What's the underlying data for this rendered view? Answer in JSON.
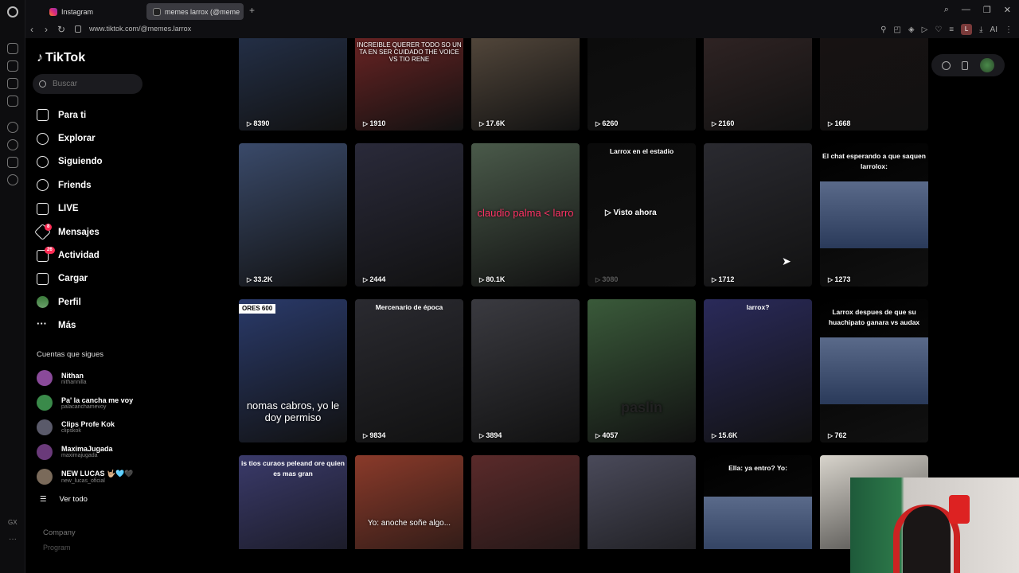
{
  "browser": {
    "tabs": [
      {
        "label": "Instagram"
      },
      {
        "label": "memes larrox (@meme"
      }
    ],
    "url": "www.tiktok.com/@memes.larrox",
    "profile_letter": "L",
    "ai_label": "AI",
    "gx_label": "GX"
  },
  "tiktok": {
    "brand": "TikTok",
    "search_placeholder": "Buscar",
    "nav": [
      {
        "label": "Para ti",
        "icon": "home-icon"
      },
      {
        "label": "Explorar",
        "icon": "compass-icon"
      },
      {
        "label": "Siguiendo",
        "icon": "person-plus-icon"
      },
      {
        "label": "Friends",
        "icon": "people-icon"
      },
      {
        "label": "LIVE",
        "icon": "live-icon"
      },
      {
        "label": "Mensajes",
        "icon": "paper-plane-icon",
        "badge": "8"
      },
      {
        "label": "Actividad",
        "icon": "inbox-icon",
        "badge": "26"
      },
      {
        "label": "Cargar",
        "icon": "plus-square-icon"
      },
      {
        "label": "Perfil",
        "icon": "avatar-icon"
      },
      {
        "label": "Más",
        "icon": "more-dots-icon"
      }
    ],
    "following_header": "Cuentas que sigues",
    "following": [
      {
        "name": "Nithan",
        "user": "nithannilla",
        "color": "#8a4a9a"
      },
      {
        "name": "Pa' la cancha me voy",
        "user": "palacanchamevoy",
        "color": "#3a8a4a"
      },
      {
        "name": "Clips Profe Kok",
        "user": "clipskok",
        "color": "#5a5a6a"
      },
      {
        "name": "MaximaJugada",
        "user": "maximajugada",
        "color": "#6a3a7a"
      },
      {
        "name": "NEW LUCAS 🤟🏼🩵🖤",
        "user": "new_lucas_oficial",
        "color": "#7a6a5a"
      }
    ],
    "see_all": "Ver todo",
    "footer": [
      "Company",
      "Program"
    ]
  },
  "videos": [
    {
      "views": "8390",
      "bg": "#2a3a5a"
    },
    {
      "views": "1910",
      "bg": "#8a2a2a",
      "caption": "INCREIBLE QUERER TODO SO UN TA EN SER CUIDADO THE VOICE VS TIO RENE"
    },
    {
      "views": "17.6K",
      "bg": "#6a5a4a"
    },
    {
      "views": "6260",
      "bg": "#0a0a0a"
    },
    {
      "views": "2160",
      "bg": "#3a2a2a"
    },
    {
      "views": "1668",
      "bg": "#1a1212"
    },
    {
      "views": "33.2K",
      "bg": "#3a4a6a"
    },
    {
      "views": "2444",
      "bg": "#2a2a3a"
    },
    {
      "views": "80.1K",
      "bg": "#4a5a4a",
      "caption": "claudio palma < larro"
    },
    {
      "views": "3080",
      "bg": "#0a0a0a",
      "top": "Larrox en el estadio",
      "watch": "▷ Visto ahora"
    },
    {
      "views": "1712",
      "bg": "#2a2a30"
    },
    {
      "views": "1273",
      "bg": "#000000",
      "top": "El chat esperando  a que saquen larrolox:"
    },
    {
      "views": "",
      "bg": "#2a3a6a",
      "caption": "nomas cabros, yo le doy permiso",
      "score": "ORES 600"
    },
    {
      "views": "9834",
      "bg": "#2a2a30",
      "top": "Mercenario de época"
    },
    {
      "views": "3894",
      "bg": "#3a3a40"
    },
    {
      "views": "4057",
      "bg": "#3a5a3a",
      "caption": "paslin"
    },
    {
      "views": "15.6K",
      "bg": "#2a2a5a",
      "top": "larrox?"
    },
    {
      "views": "762",
      "bg": "#000000",
      "top": "Larrox despues de que su huachipato  ganara vs audax"
    },
    {
      "views": "",
      "bg": "#3a3a6a",
      "top": "is tios curaos peleand ore quien es mas gran"
    },
    {
      "views": "",
      "bg": "#8a3a2a",
      "caption": "Yo: anoche soñe algo..."
    },
    {
      "views": "",
      "bg": "#5a2a2a"
    },
    {
      "views": "",
      "bg": "#4a4a5a"
    },
    {
      "views": "",
      "bg": "#000000",
      "top": "Ella: ya entro? Yo:"
    },
    {
      "views": "",
      "bg": "#d8d4cc"
    }
  ]
}
